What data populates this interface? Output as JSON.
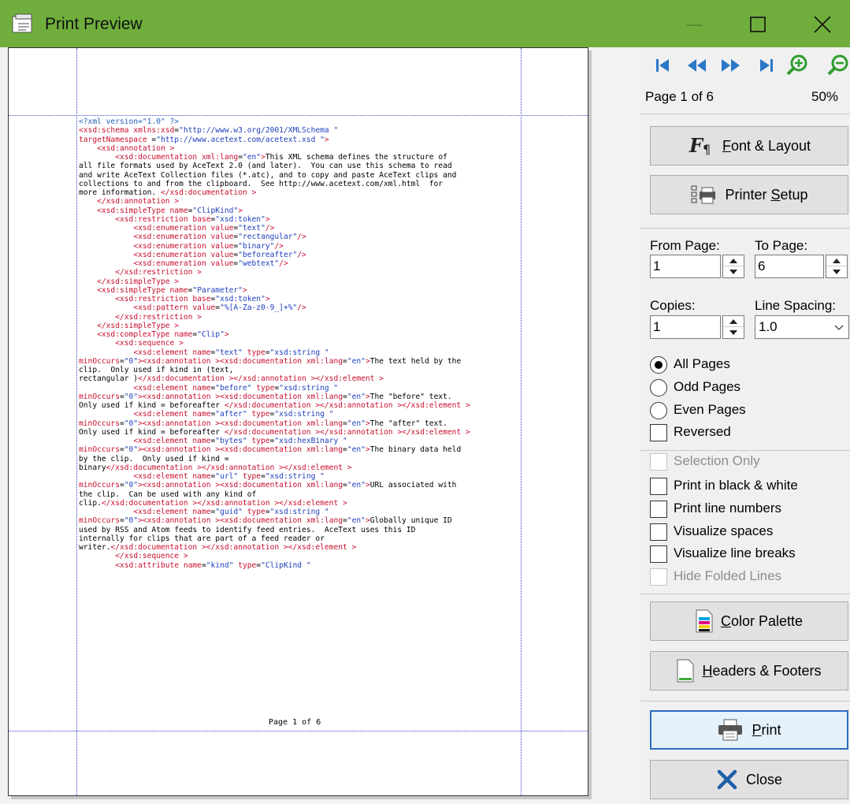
{
  "window": {
    "title": "Print Preview"
  },
  "preview": {
    "footer": "Page 1 of 6",
    "lines": [
      [
        [
          "pi",
          "<?xml version=\"1.0\" ?>"
        ]
      ],
      [
        [
          "t",
          "<xsd:schema "
        ],
        [
          "a",
          "xmlns:xsd"
        ],
        [
          "k",
          "="
        ],
        [
          "v",
          "\"http://www.w3.org/2001/XMLSchema \""
        ]
      ],
      [
        [
          "a",
          "targetNamespace "
        ],
        [
          "k",
          "="
        ],
        [
          "v",
          "\"http://www.acetext.com/acetext.xsd \""
        ],
        [
          "t",
          ">"
        ]
      ],
      [
        [
          "k",
          "    "
        ],
        [
          "t",
          "<xsd:annotation >"
        ]
      ],
      [
        [
          "k",
          "        "
        ],
        [
          "t",
          "<xsd:documentation "
        ],
        [
          "a",
          "xml:lang"
        ],
        [
          "k",
          "="
        ],
        [
          "v",
          "\"en\""
        ],
        [
          "t",
          ">"
        ],
        [
          "k",
          "This XML schema defines the structure of"
        ]
      ],
      [
        [
          "k",
          "all file formats used by AceText 2.0 (and later).  You can use this schema to read"
        ]
      ],
      [
        [
          "k",
          "and write AceText Collection files (*.atc), and to copy and paste AceText clips and"
        ]
      ],
      [
        [
          "k",
          "collections to and from the clipboard.  See http://www.acetext.com/xml.html  for"
        ]
      ],
      [
        [
          "k",
          "more information. "
        ],
        [
          "t",
          "</xsd:documentation >"
        ]
      ],
      [
        [
          "k",
          "    "
        ],
        [
          "t",
          "</xsd:annotation >"
        ]
      ],
      [
        [
          "k",
          "    "
        ],
        [
          "t",
          "<xsd:simpleType "
        ],
        [
          "a",
          "name"
        ],
        [
          "k",
          "="
        ],
        [
          "v",
          "\"ClipKind\""
        ],
        [
          "t",
          ">"
        ]
      ],
      [
        [
          "k",
          "        "
        ],
        [
          "t",
          "<xsd:restriction "
        ],
        [
          "a",
          "base"
        ],
        [
          "k",
          "="
        ],
        [
          "v",
          "\"xsd:token\""
        ],
        [
          "t",
          ">"
        ]
      ],
      [
        [
          "k",
          "            "
        ],
        [
          "t",
          "<xsd:enumeration "
        ],
        [
          "a",
          "value"
        ],
        [
          "k",
          "="
        ],
        [
          "v",
          "\"text\""
        ],
        [
          "t",
          "/>"
        ]
      ],
      [
        [
          "k",
          "            "
        ],
        [
          "t",
          "<xsd:enumeration "
        ],
        [
          "a",
          "value"
        ],
        [
          "k",
          "="
        ],
        [
          "v",
          "\"rectangular\""
        ],
        [
          "t",
          "/>"
        ]
      ],
      [
        [
          "k",
          "            "
        ],
        [
          "t",
          "<xsd:enumeration "
        ],
        [
          "a",
          "value"
        ],
        [
          "k",
          "="
        ],
        [
          "v",
          "\"binary\""
        ],
        [
          "t",
          "/>"
        ]
      ],
      [
        [
          "k",
          "            "
        ],
        [
          "t",
          "<xsd:enumeration "
        ],
        [
          "a",
          "value"
        ],
        [
          "k",
          "="
        ],
        [
          "v",
          "\"beforeafter\""
        ],
        [
          "t",
          "/>"
        ]
      ],
      [
        [
          "k",
          "            "
        ],
        [
          "t",
          "<xsd:enumeration "
        ],
        [
          "a",
          "value"
        ],
        [
          "k",
          "="
        ],
        [
          "v",
          "\"webtext\""
        ],
        [
          "t",
          "/>"
        ]
      ],
      [
        [
          "k",
          "        "
        ],
        [
          "t",
          "</xsd:restriction >"
        ]
      ],
      [
        [
          "k",
          "    "
        ],
        [
          "t",
          "</xsd:simpleType >"
        ]
      ],
      [
        [
          "k",
          "    "
        ],
        [
          "t",
          "<xsd:simpleType "
        ],
        [
          "a",
          "name"
        ],
        [
          "k",
          "="
        ],
        [
          "v",
          "\"Parameter\""
        ],
        [
          "t",
          ">"
        ]
      ],
      [
        [
          "k",
          "        "
        ],
        [
          "t",
          "<xsd:restriction "
        ],
        [
          "a",
          "base"
        ],
        [
          "k",
          "="
        ],
        [
          "v",
          "\"xsd:token\""
        ],
        [
          "t",
          ">"
        ]
      ],
      [
        [
          "k",
          "            "
        ],
        [
          "t",
          "<xsd:pattern "
        ],
        [
          "a",
          "value"
        ],
        [
          "k",
          "="
        ],
        [
          "v",
          "\"%[A-Za-z0-9_]+%\""
        ],
        [
          "t",
          "/>"
        ]
      ],
      [
        [
          "k",
          "        "
        ],
        [
          "t",
          "</xsd:restriction >"
        ]
      ],
      [
        [
          "k",
          "    "
        ],
        [
          "t",
          "</xsd:simpleType >"
        ]
      ],
      [
        [
          "k",
          "    "
        ],
        [
          "t",
          "<xsd:complexType "
        ],
        [
          "a",
          "name"
        ],
        [
          "k",
          "="
        ],
        [
          "v",
          "\"Clip\""
        ],
        [
          "t",
          ">"
        ]
      ],
      [
        [
          "k",
          "        "
        ],
        [
          "t",
          "<xsd:sequence >"
        ]
      ],
      [
        [
          "k",
          "            "
        ],
        [
          "t",
          "<xsd:element "
        ],
        [
          "a",
          "name"
        ],
        [
          "k",
          "="
        ],
        [
          "v",
          "\"text\" "
        ],
        [
          "a",
          "type"
        ],
        [
          "k",
          "="
        ],
        [
          "v",
          "\"xsd:string \""
        ]
      ],
      [
        [
          "a",
          "minOccurs"
        ],
        [
          "k",
          "="
        ],
        [
          "v",
          "\"0\""
        ],
        [
          "t",
          ">"
        ],
        [
          "t",
          "<xsd:annotation >"
        ],
        [
          "t",
          "<xsd:documentation "
        ],
        [
          "a",
          "xml:lang"
        ],
        [
          "k",
          "="
        ],
        [
          "v",
          "\"en\""
        ],
        [
          "t",
          ">"
        ],
        [
          "k",
          "The text held by the"
        ]
      ],
      [
        [
          "k",
          "clip.  Only used if kind in (text,"
        ]
      ],
      [
        [
          "k",
          "rectangular )"
        ],
        [
          "t",
          "</xsd:documentation >"
        ],
        [
          "t",
          "</xsd:annotation >"
        ],
        [
          "t",
          "</xsd:element >"
        ]
      ],
      [
        [
          "k",
          "            "
        ],
        [
          "t",
          "<xsd:element "
        ],
        [
          "a",
          "name"
        ],
        [
          "k",
          "="
        ],
        [
          "v",
          "\"before\" "
        ],
        [
          "a",
          "type"
        ],
        [
          "k",
          "="
        ],
        [
          "v",
          "\"xsd:string \""
        ]
      ],
      [
        [
          "a",
          "minOccurs"
        ],
        [
          "k",
          "="
        ],
        [
          "v",
          "\"0\""
        ],
        [
          "t",
          ">"
        ],
        [
          "t",
          "<xsd:annotation >"
        ],
        [
          "t",
          "<xsd:documentation "
        ],
        [
          "a",
          "xml:lang"
        ],
        [
          "k",
          "="
        ],
        [
          "v",
          "\"en\""
        ],
        [
          "t",
          ">"
        ],
        [
          "k",
          "The \"before\" text."
        ]
      ],
      [
        [
          "k",
          "Only used if kind = beforeafter "
        ],
        [
          "t",
          "</xsd:documentation >"
        ],
        [
          "t",
          "</xsd:annotation >"
        ],
        [
          "t",
          "</xsd:element >"
        ]
      ],
      [
        [
          "k",
          "            "
        ],
        [
          "t",
          "<xsd:element "
        ],
        [
          "a",
          "name"
        ],
        [
          "k",
          "="
        ],
        [
          "v",
          "\"after\" "
        ],
        [
          "a",
          "type"
        ],
        [
          "k",
          "="
        ],
        [
          "v",
          "\"xsd:string \""
        ]
      ],
      [
        [
          "a",
          "minOccurs"
        ],
        [
          "k",
          "="
        ],
        [
          "v",
          "\"0\""
        ],
        [
          "t",
          ">"
        ],
        [
          "t",
          "<xsd:annotation >"
        ],
        [
          "t",
          "<xsd:documentation "
        ],
        [
          "a",
          "xml:lang"
        ],
        [
          "k",
          "="
        ],
        [
          "v",
          "\"en\""
        ],
        [
          "t",
          ">"
        ],
        [
          "k",
          "The \"after\" text."
        ]
      ],
      [
        [
          "k",
          "Only used if kind = beforeafter "
        ],
        [
          "t",
          "</xsd:documentation >"
        ],
        [
          "t",
          "</xsd:annotation >"
        ],
        [
          "t",
          "</xsd:element >"
        ]
      ],
      [
        [
          "k",
          "            "
        ],
        [
          "t",
          "<xsd:element "
        ],
        [
          "a",
          "name"
        ],
        [
          "k",
          "="
        ],
        [
          "v",
          "\"bytes\" "
        ],
        [
          "a",
          "type"
        ],
        [
          "k",
          "="
        ],
        [
          "v",
          "\"xsd:hexBinary \""
        ]
      ],
      [
        [
          "a",
          "minOccurs"
        ],
        [
          "k",
          "="
        ],
        [
          "v",
          "\"0\""
        ],
        [
          "t",
          ">"
        ],
        [
          "t",
          "<xsd:annotation >"
        ],
        [
          "t",
          "<xsd:documentation "
        ],
        [
          "a",
          "xml:lang"
        ],
        [
          "k",
          "="
        ],
        [
          "v",
          "\"en\""
        ],
        [
          "t",
          ">"
        ],
        [
          "k",
          "The binary data held"
        ]
      ],
      [
        [
          "k",
          "by the clip.  Only used if kind ="
        ]
      ],
      [
        [
          "k",
          "binary"
        ],
        [
          "t",
          "</xsd:documentation >"
        ],
        [
          "t",
          "</xsd:annotation >"
        ],
        [
          "t",
          "</xsd:element >"
        ]
      ],
      [
        [
          "k",
          "            "
        ],
        [
          "t",
          "<xsd:element "
        ],
        [
          "a",
          "name"
        ],
        [
          "k",
          "="
        ],
        [
          "v",
          "\"url\" "
        ],
        [
          "a",
          "type"
        ],
        [
          "k",
          "="
        ],
        [
          "v",
          "\"xsd:string \""
        ]
      ],
      [
        [
          "a",
          "minOccurs"
        ],
        [
          "k",
          "="
        ],
        [
          "v",
          "\"0\""
        ],
        [
          "t",
          ">"
        ],
        [
          "t",
          "<xsd:annotation >"
        ],
        [
          "t",
          "<xsd:documentation "
        ],
        [
          "a",
          "xml:lang"
        ],
        [
          "k",
          "="
        ],
        [
          "v",
          "\"en\""
        ],
        [
          "t",
          ">"
        ],
        [
          "k",
          "URL associated with"
        ]
      ],
      [
        [
          "k",
          "the clip.  Can be used with any kind of"
        ]
      ],
      [
        [
          "k",
          "clip."
        ],
        [
          "t",
          "</xsd:documentation >"
        ],
        [
          "t",
          "</xsd:annotation >"
        ],
        [
          "t",
          "</xsd:element >"
        ]
      ],
      [
        [
          "k",
          "            "
        ],
        [
          "t",
          "<xsd:element "
        ],
        [
          "a",
          "name"
        ],
        [
          "k",
          "="
        ],
        [
          "v",
          "\"guid\" "
        ],
        [
          "a",
          "type"
        ],
        [
          "k",
          "="
        ],
        [
          "v",
          "\"xsd:string \""
        ]
      ],
      [
        [
          "a",
          "minOccurs"
        ],
        [
          "k",
          "="
        ],
        [
          "v",
          "\"0\""
        ],
        [
          "t",
          ">"
        ],
        [
          "t",
          "<xsd:annotation >"
        ],
        [
          "t",
          "<xsd:documentation "
        ],
        [
          "a",
          "xml:lang"
        ],
        [
          "k",
          "="
        ],
        [
          "v",
          "\"en\""
        ],
        [
          "t",
          ">"
        ],
        [
          "k",
          "Globally unique ID"
        ]
      ],
      [
        [
          "k",
          "used by RSS and Atom feeds to identify feed entries.  AceText uses this ID"
        ]
      ],
      [
        [
          "k",
          "internally for clips that are part of a feed reader or"
        ]
      ],
      [
        [
          "k",
          "writer."
        ],
        [
          "t",
          "</xsd:documentation >"
        ],
        [
          "t",
          "</xsd:annotation >"
        ],
        [
          "t",
          "</xsd:element >"
        ]
      ],
      [
        [
          "k",
          "        "
        ],
        [
          "t",
          "</xsd:sequence >"
        ]
      ],
      [
        [
          "k",
          "        "
        ],
        [
          "t",
          "<xsd:attribute "
        ],
        [
          "a",
          "name"
        ],
        [
          "k",
          "="
        ],
        [
          "v",
          "\"kind\" "
        ],
        [
          "a",
          "type"
        ],
        [
          "k",
          "="
        ],
        [
          "v",
          "\"ClipKind \""
        ]
      ]
    ]
  },
  "panel": {
    "page_info": "Page 1 of 6",
    "zoom": "50%",
    "font_layout": "Font & Layout",
    "printer_setup": "Printer Setup",
    "from_page_label": "From Page:",
    "to_page_label": "To Page:",
    "from_page_value": "1",
    "to_page_value": "6",
    "copies_label": "Copies:",
    "line_spacing_label": "Line Spacing:",
    "copies_value": "1",
    "line_spacing_value": "1.0",
    "all_pages": "All Pages",
    "odd_pages": "Odd Pages",
    "even_pages": "Even Pages",
    "reversed": "Reversed",
    "selection_only": "Selection Only",
    "black_white": "Print in black & white",
    "line_numbers": "Print line numbers",
    "visualize_spaces": "Visualize spaces",
    "visualize_breaks": "Visualize line breaks",
    "hide_folded": "Hide Folded Lines",
    "color_palette": "Color Palette",
    "headers_footers": "Headers & Footers",
    "print": "Print",
    "close": "Close"
  },
  "colors": {
    "titlebar": "#6fae3c",
    "tag": "#c8102e",
    "value": "#1f3fbf",
    "nav": "#2b78c8",
    "zoom": "#2e9c2e"
  }
}
